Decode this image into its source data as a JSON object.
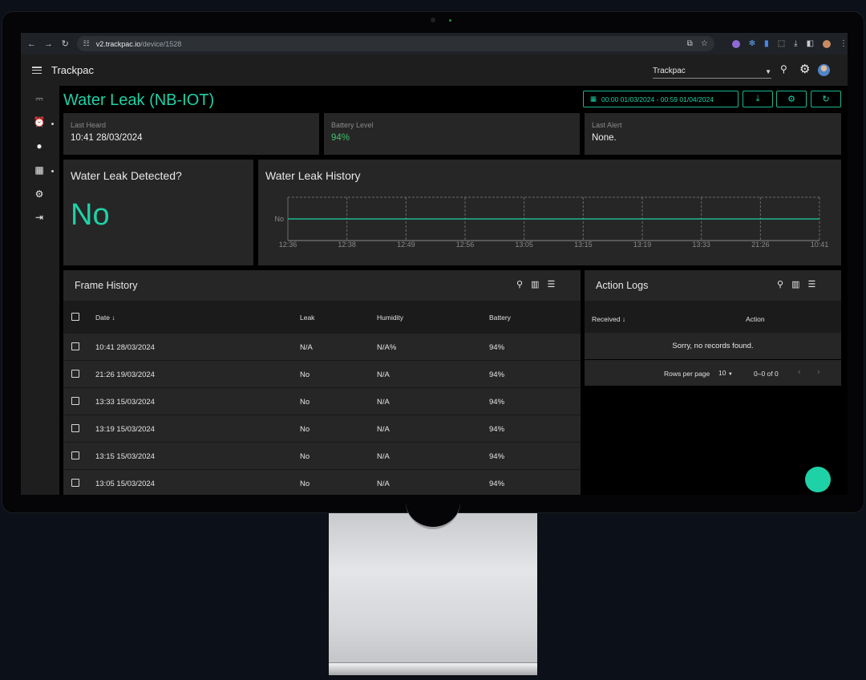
{
  "browser": {
    "url_host": "v2.trackpac.io",
    "url_path": "/device/1528"
  },
  "appbar": {
    "title": "Trackpac",
    "org_select_value": "Trackpac"
  },
  "page": {
    "title": "Water Leak (NB-IOT)",
    "date_range": "00:00 01/03/2024 - 00:59 01/04/2024"
  },
  "stats": [
    {
      "label": "Last Heard",
      "value": "10:41 28/03/2024"
    },
    {
      "label": "Battery Level",
      "value": "94%"
    },
    {
      "label": "Last Alert",
      "value": "None."
    }
  ],
  "leak_card": {
    "title": "Water Leak Detected?",
    "value": "No"
  },
  "chart_data": {
    "type": "line",
    "title": "Water Leak History",
    "y_categories": [
      "No"
    ],
    "x": [
      "12:36",
      "12:38",
      "12:49",
      "12:56",
      "13:05",
      "13:15",
      "13:19",
      "13:33",
      "21:26",
      "10:41"
    ],
    "series": [
      {
        "values": [
          "No",
          "No",
          "No",
          "No",
          "No",
          "No",
          "No",
          "No",
          "No",
          "No"
        ]
      }
    ],
    "grid": true,
    "line_color": "#1fb58f"
  },
  "frame_history": {
    "title": "Frame History",
    "columns": [
      "Date",
      "Leak",
      "Humidity",
      "Battery"
    ],
    "rows": [
      {
        "date": "10:41 28/03/2024",
        "leak": "N/A",
        "humidity": "N/A%",
        "battery": "94%"
      },
      {
        "date": "21:26 19/03/2024",
        "leak": "No",
        "humidity": "N/A",
        "battery": "94%"
      },
      {
        "date": "13:33 15/03/2024",
        "leak": "No",
        "humidity": "N/A",
        "battery": "94%"
      },
      {
        "date": "13:19 15/03/2024",
        "leak": "No",
        "humidity": "N/A",
        "battery": "94%"
      },
      {
        "date": "13:15 15/03/2024",
        "leak": "No",
        "humidity": "N/A",
        "battery": "94%"
      },
      {
        "date": "13:05 15/03/2024",
        "leak": "No",
        "humidity": "N/A",
        "battery": "94%"
      }
    ]
  },
  "action_logs": {
    "title": "Action Logs",
    "columns": [
      "Received",
      "Action"
    ],
    "empty_message": "Sorry, no records found.",
    "rows_per_page_label": "Rows per page",
    "rows_per_page_value": "10",
    "pagination": "0–0 of 0"
  },
  "colors": {
    "accent": "#1fd1a6",
    "battery_green": "#3ec16a",
    "card_bg": "#262626"
  }
}
